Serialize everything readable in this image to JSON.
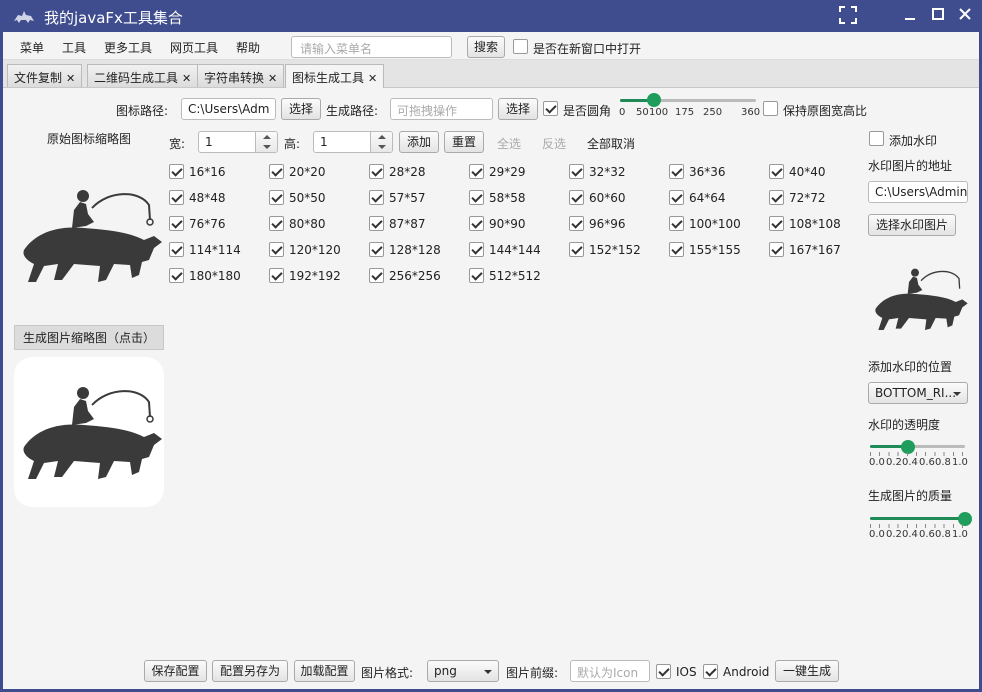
{
  "window": {
    "title": "我的javaFx工具集合",
    "title_color": "#3f4c8e",
    "accent_color": "#1f9d5c"
  },
  "menubar": {
    "items": [
      "菜单",
      "工具",
      "更多工具",
      "网页工具",
      "帮助"
    ],
    "search_placeholder": "请输入菜单名",
    "search_button": "搜索",
    "new_window_label": "是否在新窗口中打开"
  },
  "tabs": [
    {
      "label": "文件复制",
      "active": false
    },
    {
      "label": "二维码生成工具",
      "active": false
    },
    {
      "label": "字符串转换",
      "active": false
    },
    {
      "label": "图标生成工具",
      "active": true
    }
  ],
  "paths": {
    "icon_path_label": "图标路径:",
    "icon_path_value": "C:\\Users\\Adm",
    "select_button": "选择",
    "output_path_label": "生成路径:",
    "output_path_placeholder": "可拖拽操作",
    "round_corner_label": "是否圆角",
    "corner_ticks": [
      "0",
      "50",
      "100",
      "175",
      "250",
      "360"
    ],
    "corner_value": 100,
    "keep_ratio_label": "保持原图宽高比"
  },
  "original": {
    "label": "原始图标缩略图"
  },
  "size_controls": {
    "width_label": "宽:",
    "width_value": "1",
    "height_label": "高:",
    "height_value": "1",
    "add_button": "添加",
    "reset_button": "重置",
    "select_all": "全选",
    "invert": "反选",
    "cancel_all": "全部取消"
  },
  "sizes": [
    [
      "16*16",
      "20*20",
      "28*28",
      "29*29",
      "32*32",
      "36*36",
      "40*40"
    ],
    [
      "48*48",
      "50*50",
      "57*57",
      "58*58",
      "60*60",
      "64*64",
      "72*72"
    ],
    [
      "76*76",
      "80*80",
      "87*87",
      "90*90",
      "96*96",
      "100*100",
      "108*108"
    ],
    [
      "114*114",
      "120*120",
      "128*128",
      "144*144",
      "152*152",
      "155*155",
      "167*167"
    ],
    [
      "180*180",
      "192*192",
      "256*256",
      "512*512"
    ]
  ],
  "generated": {
    "button": "生成图片缩略图（点击）"
  },
  "watermark": {
    "add_label": "添加水印",
    "address_label": "水印图片的地址",
    "address_value": "C:\\Users\\Admin",
    "select_button": "选择水印图片",
    "position_label": "添加水印的位置",
    "position_value": "BOTTOM_RI...",
    "opacity_label": "水印的透明度",
    "opacity_value": 0.4,
    "quality_label": "生成图片的质量",
    "quality_value": 1.0,
    "slider_ticks": [
      "0.0",
      "0.2",
      "0.4",
      "0.6",
      "0.8",
      "1.0"
    ]
  },
  "footer": {
    "save_config": "保存配置",
    "save_as": "配置另存为",
    "load_config": "加载配置",
    "format_label": "图片格式:",
    "format_value": "png",
    "prefix_label": "图片前缀:",
    "prefix_placeholder": "默认为Icon",
    "ios_label": "IOS",
    "android_label": "Android",
    "generate_button": "一键生成"
  }
}
